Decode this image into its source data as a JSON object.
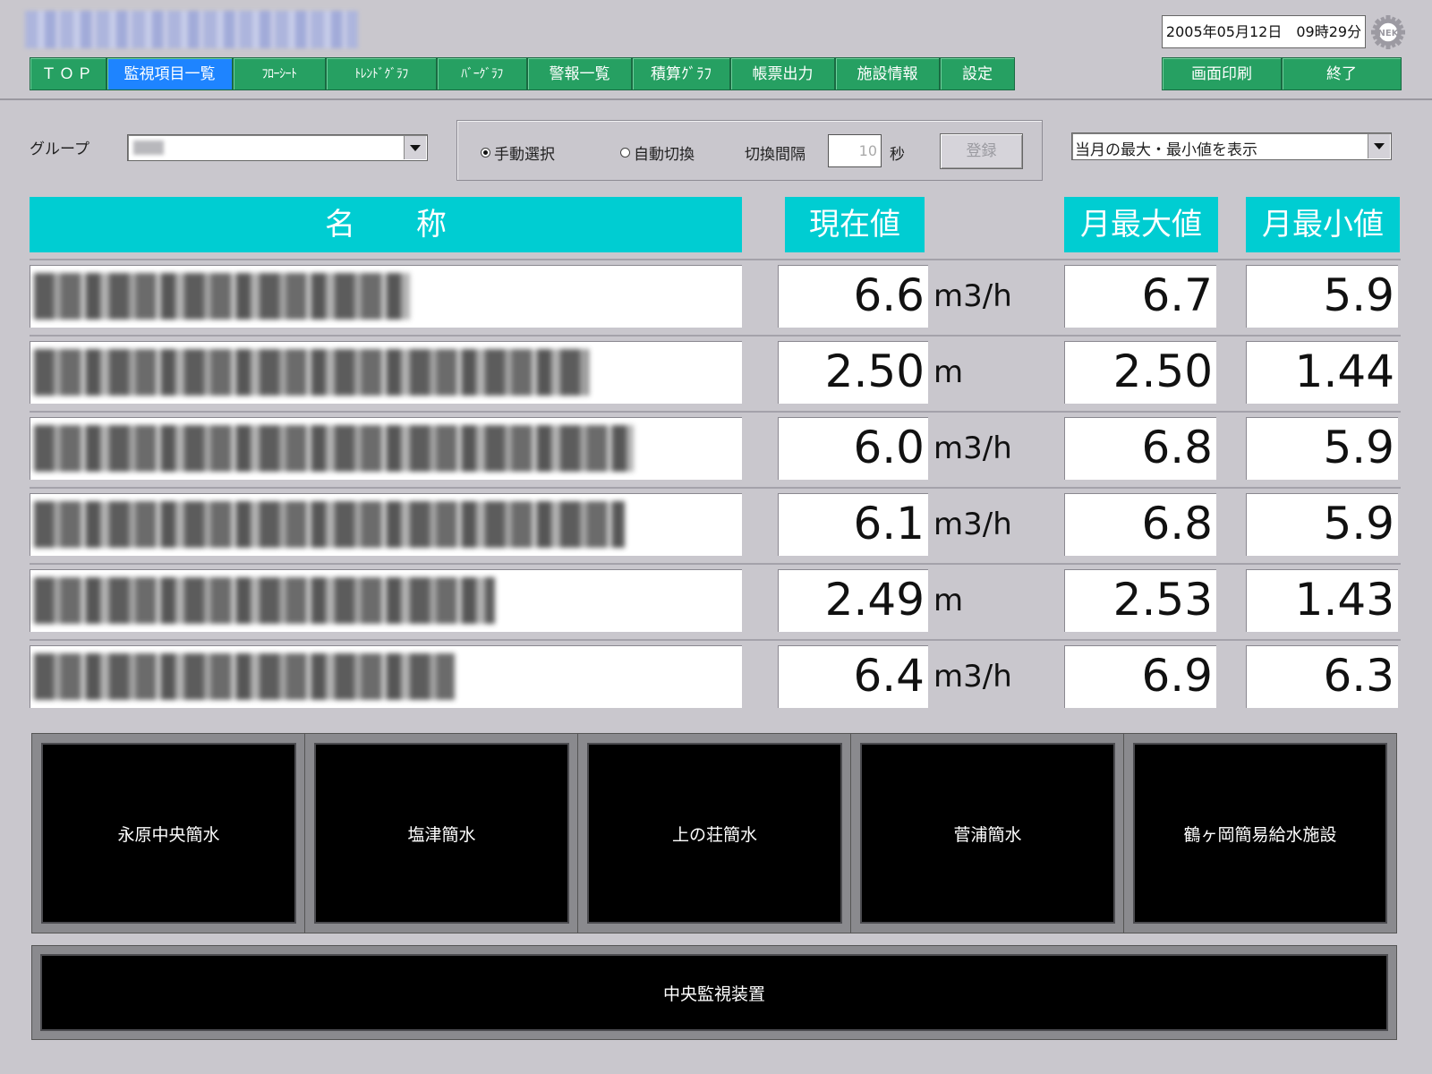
{
  "header": {
    "datetime": "2005年05月12日　09時29分",
    "logo_text": "NEK",
    "tabs": [
      {
        "label": "ＴＯＰ",
        "active": false
      },
      {
        "label": "監視項目一覧",
        "active": true
      },
      {
        "label": "ﾌﾛｰｼｰﾄ",
        "active": false
      },
      {
        "label": "ﾄﾚﾝﾄﾞｸﾞﾗﾌ",
        "active": false
      },
      {
        "label": "ﾊﾞｰｸﾞﾗﾌ",
        "active": false
      },
      {
        "label": "警報一覧",
        "active": false
      },
      {
        "label": "積算ｸﾞﾗﾌ",
        "active": false
      },
      {
        "label": "帳票出力",
        "active": false
      },
      {
        "label": "施設情報",
        "active": false
      },
      {
        "label": "設定",
        "active": false
      }
    ],
    "print_button": "画面印刷",
    "exit_button": "終了"
  },
  "controls": {
    "group_label": "グループ",
    "mode_manual": "手動選択",
    "mode_auto": "自動切換",
    "interval_label": "切換間隔",
    "interval_value": "10",
    "interval_unit": "秒",
    "register_button": "登録",
    "range_select": "当月の最大・最小値を表示"
  },
  "table": {
    "headers": {
      "name": "名　　称",
      "current": "現在値",
      "max": "月最大値",
      "min": "月最小値"
    },
    "rows": [
      {
        "current": "6.6",
        "unit": "m3/h",
        "max": "6.7",
        "min": "5.9"
      },
      {
        "current": "2.50",
        "unit": "m",
        "max": "2.50",
        "min": "1.44"
      },
      {
        "current": "6.0",
        "unit": "m3/h",
        "max": "6.8",
        "min": "5.9"
      },
      {
        "current": "6.1",
        "unit": "m3/h",
        "max": "6.8",
        "min": "5.9"
      },
      {
        "current": "2.49",
        "unit": "m",
        "max": "2.53",
        "min": "1.43"
      },
      {
        "current": "6.4",
        "unit": "m3/h",
        "max": "6.9",
        "min": "6.3"
      }
    ]
  },
  "facilities": [
    "永原中央簡水",
    "塩津簡水",
    "上の荘簡水",
    "菅浦簡水",
    "鶴ヶ岡簡易給水施設"
  ],
  "central": "中央監視装置"
}
